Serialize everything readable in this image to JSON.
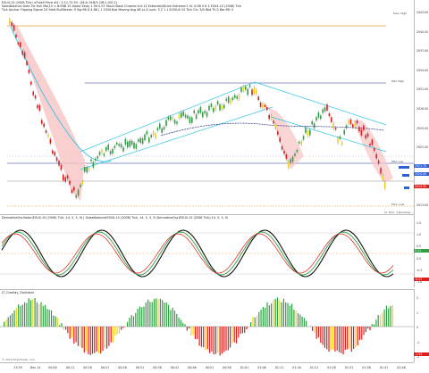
{
  "panes": {
    "price_header_1": "ESU4-15 (2008 Tick) ×Futs9 Price #4 : 0 11.73 50 : [M:A: M:B/3 2/R:1.0/0.1]",
    "price_header_2": "SalesBalance Area Tie Hull Ma(15 × B:EBB 15 Alpha Zero) 1.94 0.07 Stoch:Dash Chrome:4:0:13 Extended/Drive Extreme:2 41 0:0B 0 8 3 ESU4-15 (2008) Tick",
    "price_header_3": "Tick Anchor Flipping Signal 24 Yield BullStreak: 9 Sig:RE:4 4.86 | 1 1044 Box Moving Avg 48 Ls 4 Lock: 3 2 1 1 B ESU4 15 Tick Ctr: 3/4 Wid Th:2 Bar:Filt 3",
    "osc_header": "DerivativeOscillator(ESU4-15 (2008) Tick, 14, 5, 3, 9) | SalesBalance(ESU4-15 (2008) Tick, 14, 5, 3, 9) DerivativeOsc(ESU4-15 (2008 Tick),14, 5, 3, 9)",
    "hist_header": "LT_Overlay_Oscillator"
  },
  "price_axis": {
    "ticks": [
      "2943.00",
      "2940.00",
      "2937.00",
      "2934.00",
      "2931.00",
      "2928.00",
      "2925.00",
      "2922.00",
      "2919.00",
      "2916.00",
      "2913.00"
    ],
    "last_price": "2919.50",
    "badge_blue_1": "2921.75",
    "badge_blue_2": "2920.00",
    "badge_red": "2919.50"
  },
  "price_labels": {
    "prev_high": "Prev. High",
    "poc_high": "POC High",
    "poc_low": "POC Low",
    "prev_low": "Prev. Low",
    "bottom_note": "Lt. Trim: 1 Roundup - 15s"
  },
  "osc_axis": {
    "ticks": [
      "1.5",
      "1.0",
      "0.5",
      "0.0",
      "-0.5",
      "-1.0"
    ],
    "badge_green": "0.31",
    "badge_red": "-0.47"
  },
  "hist_axis": {
    "ticks": [
      "2",
      "1",
      "0",
      "-1",
      "-2"
    ],
    "badge_red": "-1.54"
  },
  "xaxis": {
    "ticks": [
      "23:59",
      "Dec 14",
      "00:00",
      "00:11",
      "00:16",
      "00:21",
      "00:26",
      "00:31",
      "00:36",
      "00:41",
      "00:46",
      "00:51",
      "00:56",
      "01:01",
      "01:06",
      "01:11",
      "01:16",
      "01:21",
      "01:26",
      "01:31",
      "01:36",
      "01:41",
      "01:46"
    ]
  },
  "copyright": "© 2019 NinjaTrader, LLC",
  "colors": {
    "bull": "#2ea043",
    "bear": "#e01b1b",
    "neutral": "#f2d21b",
    "cyan": "#31c5e8",
    "navy": "#1f2a8a",
    "orange": "#e5a23a",
    "pink_fill": "#f7c3c3"
  }
}
